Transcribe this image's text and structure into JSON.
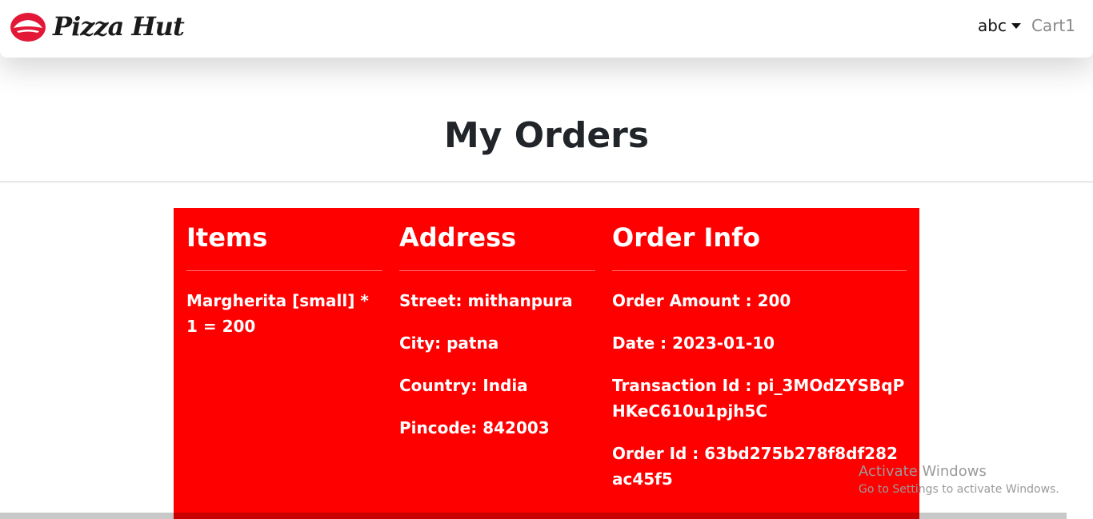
{
  "navbar": {
    "brand_name": "Pizza Hut",
    "user_label": "abc",
    "cart_label": "Cart",
    "cart_count": "1"
  },
  "page": {
    "title": "My Orders"
  },
  "order": {
    "items_heading": "Items",
    "address_heading": "Address",
    "info_heading": "Order Info",
    "items": [
      "Margherita [small] * 1 = 200"
    ],
    "address": {
      "street": "Street: mithanpura",
      "city": "City: patna",
      "country": "Country: India",
      "pincode": "Pincode: 842003"
    },
    "info": {
      "amount": "Order Amount : 200",
      "date": "Date : 2023-01-10",
      "transaction": "Transaction Id : pi_3MOdZYSBqPHKeC610u1pjh5C",
      "order_id": "Order Id : 63bd275b278f8df282ac45f5"
    }
  },
  "watermark": {
    "title": "Activate Windows",
    "subtitle": "Go to Settings to activate Windows."
  },
  "colors": {
    "card": "#ff0000",
    "brand_red": "#e31837",
    "text_dark": "#212529",
    "cart_gray": "#8a8a8a"
  },
  "icons": {
    "brand": "pizza-hut-roof-logo-icon",
    "user_dropdown": "caret-down-icon"
  }
}
